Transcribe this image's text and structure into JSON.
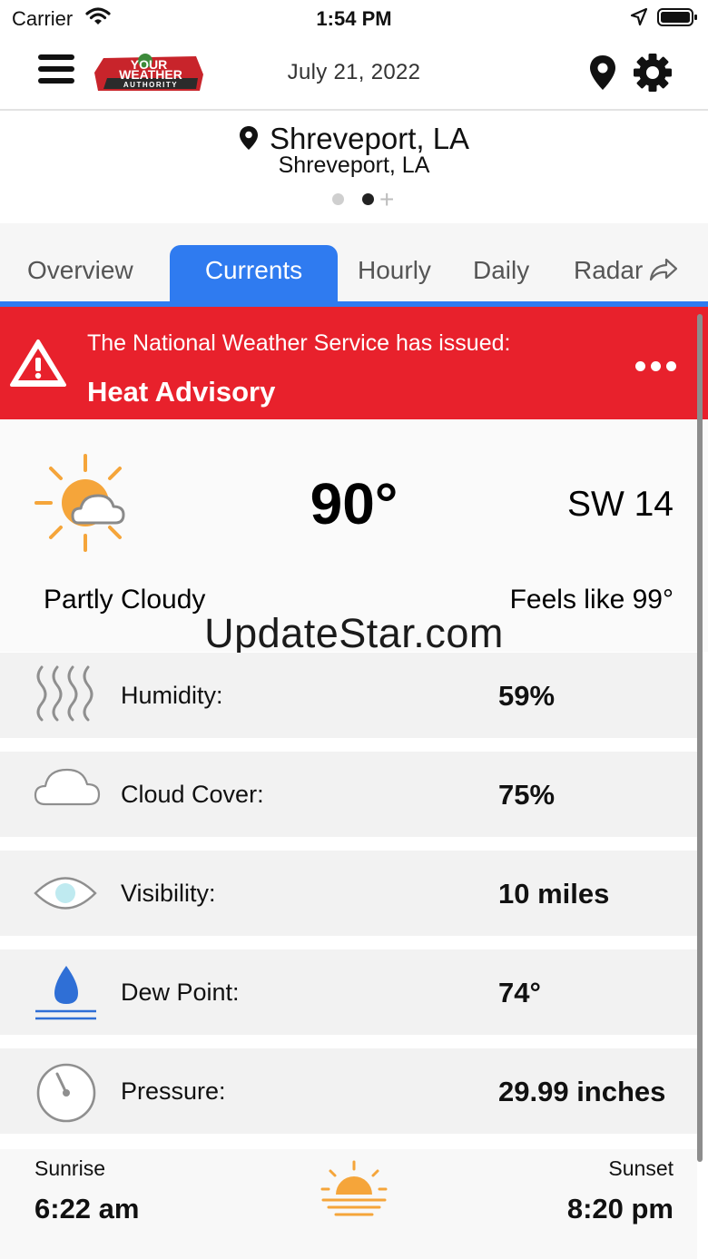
{
  "status_bar": {
    "carrier": "Carrier",
    "time": "1:54 PM",
    "icons": [
      "wifi-icon",
      "location-arrow-icon",
      "battery-icon"
    ]
  },
  "header": {
    "logo_text": [
      "YOUR",
      "WEATHER",
      "AUTHORITY"
    ],
    "date": "July 21, 2022",
    "icons": [
      "menu-icon",
      "map-pin-icon",
      "gear-icon"
    ]
  },
  "location": {
    "name": "Shreveport, LA",
    "subtitle": "Shreveport, LA",
    "pages": 2,
    "active_page": 2
  },
  "tabs": [
    {
      "label": "Overview",
      "active": false
    },
    {
      "label": "Currents",
      "active": true
    },
    {
      "label": "Hourly",
      "active": false
    },
    {
      "label": "Daily",
      "active": false
    },
    {
      "label": "Radar",
      "active": false
    }
  ],
  "alert": {
    "intro": "The National Weather Service has issued:",
    "title": "Heat Advisory",
    "color": "#e8212c"
  },
  "current": {
    "icon": "partly-cloudy-icon",
    "temperature": "90°",
    "wind": "SW 14",
    "condition": "Partly Cloudy",
    "feels_like": "Feels like 99°"
  },
  "watermark": "UpdateStar.com",
  "details": [
    {
      "icon": "humidity-icon",
      "label": "Humidity:",
      "value": "59%"
    },
    {
      "icon": "cloud-icon",
      "label": "Cloud Cover:",
      "value": "75%"
    },
    {
      "icon": "eye-icon",
      "label": "Visibility:",
      "value": "10 miles"
    },
    {
      "icon": "dew-drop-icon",
      "label": "Dew Point:",
      "value": "74°"
    },
    {
      "icon": "gauge-icon",
      "label": "Pressure:",
      "value": "29.99 inches"
    }
  ],
  "sun": {
    "sunrise_label": "Sunrise",
    "sunrise": "6:22 am",
    "sunset_label": "Sunset",
    "sunset": "8:20 pm",
    "icon": "sunset-icon"
  },
  "colors": {
    "accent": "#2f7bf0",
    "alert": "#e8212c",
    "sun": "#f5a53a"
  }
}
